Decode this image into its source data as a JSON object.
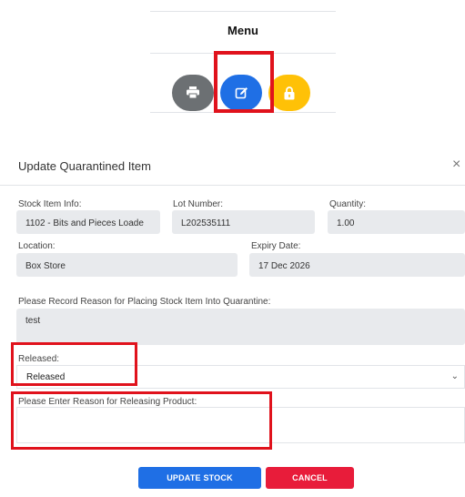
{
  "menu": {
    "title": "Menu"
  },
  "icons": {
    "print": "print-icon",
    "edit": "edit-icon",
    "lock": "lock-icon",
    "close": "close-icon",
    "chevron": "chevron-down-icon"
  },
  "colors": {
    "primary": "#1f6fe5",
    "danger": "#e81c3a",
    "warning": "#ffc107",
    "secondary": "#6c7073",
    "highlight": "#e0121c"
  },
  "modal": {
    "title": "Update Quarantined Item",
    "close_glyph": "×",
    "stock_item_label": "Stock Item Info:",
    "stock_item_value": "1102 - Bits and Pieces Loade",
    "lot_number_label": "Lot Number:",
    "lot_number_value": "L202535111",
    "quantity_label": "Quantity:",
    "quantity_value": "1.00",
    "location_label": "Location:",
    "location_value": "Box Store",
    "expiry_label": "Expiry Date:",
    "expiry_value": "17 Dec 2026",
    "reason_label": "Please Record Reason for Placing Stock Item Into Quarantine:",
    "reason_value": "test",
    "released_label": "Released:",
    "released_value": "Released",
    "release_reason_label": "Please Enter Reason for Releasing Product:",
    "release_reason_value": "",
    "update_button": "UPDATE STOCK",
    "cancel_button": "CANCEL"
  }
}
